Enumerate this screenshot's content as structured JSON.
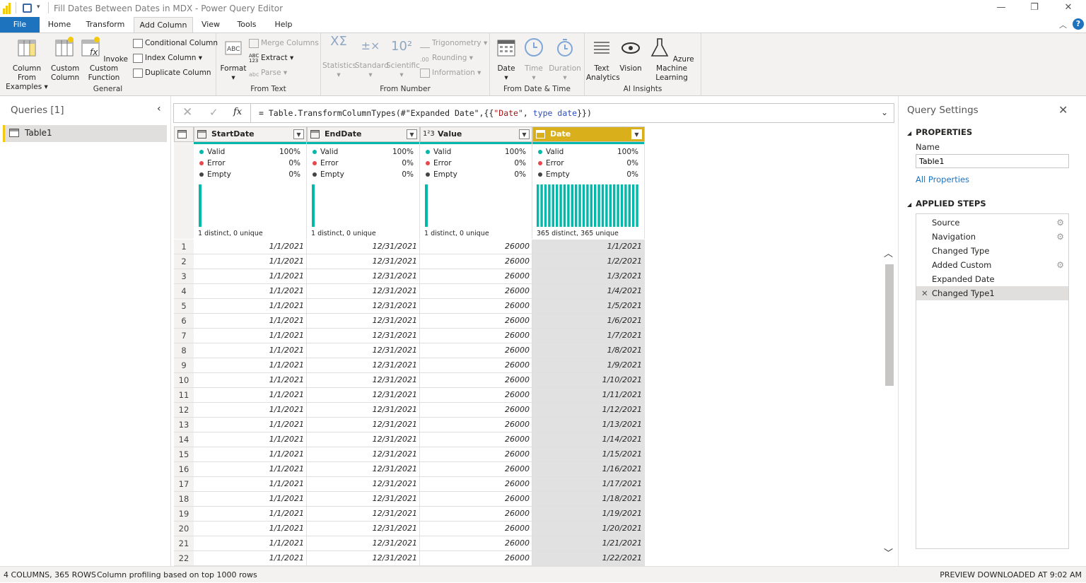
{
  "window": {
    "title": "Fill Dates Between Dates in MDX - Power Query Editor"
  },
  "tabs": [
    "File",
    "Home",
    "Transform",
    "Add Column",
    "View",
    "Tools",
    "Help"
  ],
  "ribbon": {
    "general": {
      "label": "General",
      "col_from_examples": "Column From Examples",
      "custom_column": "Custom Column",
      "invoke_custom_function": "Invoke Custom Function",
      "conditional_column": "Conditional Column",
      "index_column": "Index Column",
      "duplicate_column": "Duplicate Column"
    },
    "from_text": {
      "label": "From Text",
      "format": "Format",
      "merge_columns": "Merge Columns",
      "extract": "Extract",
      "parse": "Parse"
    },
    "from_number": {
      "label": "From Number",
      "statistics": "Statistics",
      "standard": "Standard",
      "scientific": "Scientific",
      "trigonometry": "Trigonometry",
      "rounding": "Rounding",
      "information": "Information"
    },
    "from_datetime": {
      "label": "From Date & Time",
      "date": "Date",
      "time": "Time",
      "duration": "Duration"
    },
    "ai": {
      "label": "AI Insights",
      "text_analytics": "Text Analytics",
      "vision": "Vision",
      "azure_ml": "Azure Machine Learning"
    }
  },
  "queries": {
    "header": "Queries [1]",
    "items": [
      "Table1"
    ]
  },
  "formula": {
    "prefix": "= Table.TransformColumnTypes(#\"Expanded Date\",{{",
    "str": "\"Date\"",
    "mid": ", ",
    "kw1": "type",
    "sp": " ",
    "kw2": "date",
    "suffix": "}})"
  },
  "columns": [
    {
      "name": "StartDate",
      "type": "date",
      "valid": "100%",
      "error": "0%",
      "empty": "0%",
      "distinct": "1 distinct, 0 unique"
    },
    {
      "name": "EndDate",
      "type": "date",
      "valid": "100%",
      "error": "0%",
      "empty": "0%",
      "distinct": "1 distinct, 0 unique"
    },
    {
      "name": "Value",
      "type": "number",
      "valid": "100%",
      "error": "0%",
      "empty": "0%",
      "distinct": "1 distinct, 0 unique"
    },
    {
      "name": "Date",
      "type": "date",
      "valid": "100%",
      "error": "0%",
      "empty": "0%",
      "distinct": "365 distinct, 365 unique"
    }
  ],
  "profile_labels": {
    "valid": "Valid",
    "error": "Error",
    "empty": "Empty"
  },
  "rows": [
    [
      "1",
      "1/1/2021",
      "12/31/2021",
      "26000",
      "1/1/2021"
    ],
    [
      "2",
      "1/1/2021",
      "12/31/2021",
      "26000",
      "1/2/2021"
    ],
    [
      "3",
      "1/1/2021",
      "12/31/2021",
      "26000",
      "1/3/2021"
    ],
    [
      "4",
      "1/1/2021",
      "12/31/2021",
      "26000",
      "1/4/2021"
    ],
    [
      "5",
      "1/1/2021",
      "12/31/2021",
      "26000",
      "1/5/2021"
    ],
    [
      "6",
      "1/1/2021",
      "12/31/2021",
      "26000",
      "1/6/2021"
    ],
    [
      "7",
      "1/1/2021",
      "12/31/2021",
      "26000",
      "1/7/2021"
    ],
    [
      "8",
      "1/1/2021",
      "12/31/2021",
      "26000",
      "1/8/2021"
    ],
    [
      "9",
      "1/1/2021",
      "12/31/2021",
      "26000",
      "1/9/2021"
    ],
    [
      "10",
      "1/1/2021",
      "12/31/2021",
      "26000",
      "1/10/2021"
    ],
    [
      "11",
      "1/1/2021",
      "12/31/2021",
      "26000",
      "1/11/2021"
    ],
    [
      "12",
      "1/1/2021",
      "12/31/2021",
      "26000",
      "1/12/2021"
    ],
    [
      "13",
      "1/1/2021",
      "12/31/2021",
      "26000",
      "1/13/2021"
    ],
    [
      "14",
      "1/1/2021",
      "12/31/2021",
      "26000",
      "1/14/2021"
    ],
    [
      "15",
      "1/1/2021",
      "12/31/2021",
      "26000",
      "1/15/2021"
    ],
    [
      "16",
      "1/1/2021",
      "12/31/2021",
      "26000",
      "1/16/2021"
    ],
    [
      "17",
      "1/1/2021",
      "12/31/2021",
      "26000",
      "1/17/2021"
    ],
    [
      "18",
      "1/1/2021",
      "12/31/2021",
      "26000",
      "1/18/2021"
    ],
    [
      "19",
      "1/1/2021",
      "12/31/2021",
      "26000",
      "1/19/2021"
    ],
    [
      "20",
      "1/1/2021",
      "12/31/2021",
      "26000",
      "1/20/2021"
    ],
    [
      "21",
      "1/1/2021",
      "12/31/2021",
      "26000",
      "1/21/2021"
    ],
    [
      "22",
      "1/1/2021",
      "12/31/2021",
      "26000",
      "1/22/2021"
    ]
  ],
  "settings": {
    "header": "Query Settings",
    "properties": "PROPERTIES",
    "name_label": "Name",
    "name_value": "Table1",
    "all_properties": "All Properties",
    "applied_steps": "APPLIED STEPS",
    "steps": [
      {
        "label": "Source",
        "gear": true
      },
      {
        "label": "Navigation",
        "gear": true
      },
      {
        "label": "Changed Type",
        "gear": false
      },
      {
        "label": "Added Custom",
        "gear": true
      },
      {
        "label": "Expanded Date",
        "gear": false
      },
      {
        "label": "Changed Type1",
        "gear": false
      }
    ]
  },
  "status": {
    "counts": "4 COLUMNS, 365 ROWS",
    "profiling": "Column profiling based on top 1000 rows",
    "preview": "PREVIEW DOWNLOADED AT 9:02 AM"
  },
  "colors": {
    "accent": "#f2c811",
    "teal": "#01b8aa",
    "file_tab": "#1e73be",
    "selected_header": "#d9b01c"
  }
}
